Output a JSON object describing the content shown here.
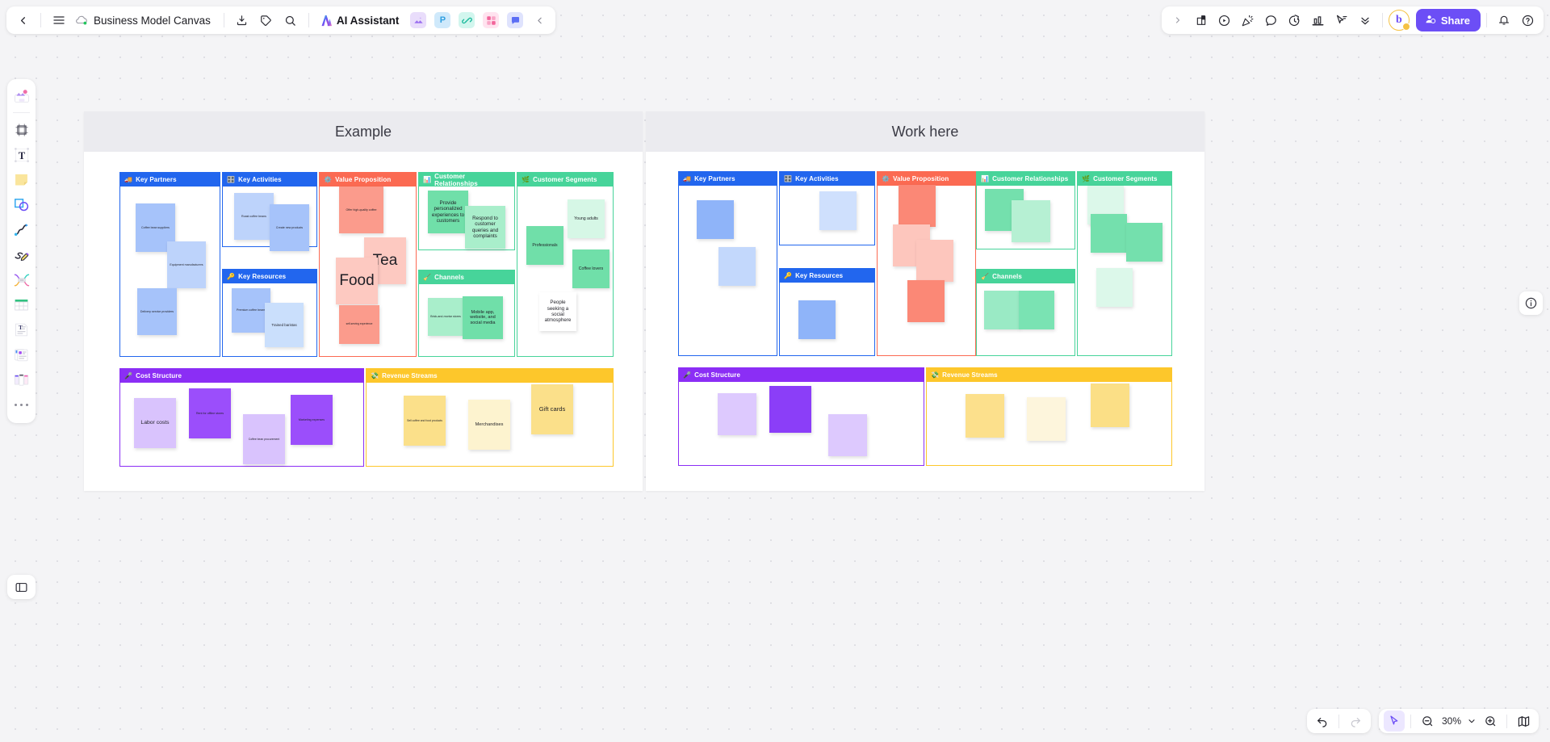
{
  "topbar": {
    "back_icon": "chevron-left-icon",
    "menu_icon": "hamburger-menu-icon",
    "doc_title": "Business Model Canvas",
    "download_icon": "download-icon",
    "tag_icon": "tag-icon",
    "search_icon": "search-icon",
    "ai_assistant_label": "AI Assistant",
    "chips": [
      {
        "name": "image-tool",
        "letter": "",
        "bg": "#e9ddfb",
        "fg": "#8b5cf6"
      },
      {
        "name": "presentation-tool",
        "letter": "P",
        "bg": "#cfe9fb",
        "fg": "#2f9fe0"
      },
      {
        "name": "link-tool",
        "letter": "",
        "bg": "#d2f6ee",
        "fg": "#17b89a"
      },
      {
        "name": "grid-tool",
        "letter": "",
        "bg": "#ffe3ef",
        "fg": "#f2649a"
      },
      {
        "name": "comment-tool",
        "letter": "",
        "bg": "#dfe3fd",
        "fg": "#5b6ef5"
      }
    ],
    "collapse_icon": "chevron-left-collapse-icon",
    "right_expand_icon": "chevron-right-icon",
    "right_icons": [
      "present-file-icon",
      "play-circle-icon",
      "party-popper-icon",
      "comment-bubble-icon",
      "timer-icon",
      "chart-bar-icon",
      "cursor-vote-icon",
      "chevrons-down-icon"
    ],
    "share_label": "Share",
    "share_icon": "user-add-icon",
    "share_color": "#6c4ef6",
    "avatar_letter": "b",
    "bell_icon": "bell-icon",
    "help_icon": "help-circle-icon"
  },
  "left_toolbar": {
    "items": [
      {
        "name": "templates-icon",
        "label": "Templates"
      },
      {
        "name": "frame-icon",
        "label": "Frame"
      },
      {
        "name": "text-icon",
        "label": "Text"
      },
      {
        "name": "sticky-note-icon",
        "label": "Sticky note"
      },
      {
        "name": "shapes-icon",
        "label": "Shapes"
      },
      {
        "name": "connector-icon",
        "label": "Connector line"
      },
      {
        "name": "pen-icon",
        "label": "Pen"
      },
      {
        "name": "mindmap-icon",
        "label": "Mind map"
      },
      {
        "name": "table-icon",
        "label": "Table"
      },
      {
        "name": "document-icon",
        "label": "Document"
      },
      {
        "name": "card-icon",
        "label": "Card"
      },
      {
        "name": "kanban-icon",
        "label": "Kanban"
      },
      {
        "name": "more-icon",
        "label": "More"
      }
    ],
    "bottom_item": {
      "name": "open-panel-icon",
      "label": "Open panel"
    }
  },
  "right_panel": {
    "info_icon": "info-circle-icon"
  },
  "bottom_bar": {
    "undo_icon": "undo-icon",
    "redo_icon": "redo-icon",
    "cursor_icon": "cursor-select-icon",
    "zoom_out_icon": "zoom-out-icon",
    "zoom_level": "30%",
    "zoom_dropdown_icon": "chevron-down-icon",
    "zoom_in_icon": "zoom-in-icon",
    "minimap_icon": "minimap-icon",
    "accent": "#6c4ef6"
  },
  "canvas": {
    "frames": [
      {
        "name": "frame-example",
        "title": "Example"
      },
      {
        "name": "frame-work-here",
        "title": "Work here"
      }
    ],
    "section_colors": {
      "key_partners": "#2266ee",
      "key_activities": "#2266ee",
      "key_resources": "#2266ee",
      "value_proposition": "#fb6a52",
      "customer_relationships": "#47d49a",
      "channels": "#47d49a",
      "customer_segments": "#47d49a",
      "cost_structure": "#8b2ef5",
      "revenue_streams": "#fdc72b"
    },
    "sections": [
      {
        "key": "key_partners",
        "title": "Key Partners",
        "emoji": "🚚"
      },
      {
        "key": "key_activities",
        "title": "Key Activities",
        "emoji": "🎛️"
      },
      {
        "key": "key_resources",
        "title": "Key Resources",
        "emoji": "🔑"
      },
      {
        "key": "value_proposition",
        "title": "Value Proposition",
        "emoji": "⚙️"
      },
      {
        "key": "customer_relationships",
        "title": "Customer Relationships",
        "emoji": "📊"
      },
      {
        "key": "channels",
        "title": "Channels",
        "emoji": "🧹"
      },
      {
        "key": "customer_segments",
        "title": "Customer Segments",
        "emoji": "🌿"
      },
      {
        "key": "cost_structure",
        "title": "Cost Structure",
        "emoji": "🎤"
      },
      {
        "key": "revenue_streams",
        "title": "Revenue Streams",
        "emoji": "💸"
      }
    ],
    "example_notes": {
      "key_partners": [
        {
          "text": "Coffee bean suppliers",
          "color": "#a6c3fa"
        },
        {
          "text": "Equipment manufacturers",
          "color": "#bdd3fb"
        },
        {
          "text": "Delivery service providers",
          "color": "#a6c3fa"
        }
      ],
      "key_activities": [
        {
          "text": "Roast coffee beans",
          "color": "#bdd3fb"
        },
        {
          "text": "Create new products",
          "color": "#a6c3fa"
        }
      ],
      "key_resources": [
        {
          "text": "Premium coffee beans",
          "color": "#a6c3fa"
        },
        {
          "text": "Trained baristas",
          "color": "#cadffc"
        }
      ],
      "value_proposition": [
        {
          "text": "Offer high-quality coffee",
          "color": "#fb9b8c"
        },
        {
          "text": "Tea",
          "color": "#fdc9c1"
        },
        {
          "text": "Food",
          "color": "#fdc9c1"
        },
        {
          "text": "self-serving experience",
          "color": "#fb9b8c"
        }
      ],
      "customer_relationships": [
        {
          "text": "Provide personalized experiences to customers",
          "color": "#70dfa9"
        },
        {
          "text": "Respond to customer queries and complaints",
          "color": "#a9eecb"
        }
      ],
      "channels": [
        {
          "text": "Brick-and-mortar stores",
          "color": "#a9eecb"
        },
        {
          "text": "Mobile app, website, and social media",
          "color": "#70dfa9"
        }
      ],
      "customer_segments": [
        {
          "text": "Professionals",
          "color": "#70dfa9"
        },
        {
          "text": "Young adults",
          "color": "#d6f7e6"
        },
        {
          "text": "Coffee lovers",
          "color": "#70dfa9"
        },
        {
          "text": "People seeking a social atmosphere",
          "color": "#ffffff"
        }
      ],
      "cost_structure": [
        {
          "text": "Labor costs",
          "color": "#d9c3fd"
        },
        {
          "text": "Rent for offline stores",
          "color": "#9b4efb"
        },
        {
          "text": "Coffee bean procurement",
          "color": "#d9c3fd"
        },
        {
          "text": "Marketing expenses",
          "color": "#9b4efb"
        }
      ],
      "revenue_streams": [
        {
          "text": "Sell coffee and food products",
          "color": "#fbe08a"
        },
        {
          "text": "Merchandises",
          "color": "#fdf3cf"
        },
        {
          "text": "Gift cards",
          "color": "#fbe08a"
        }
      ]
    },
    "work_notes": {
      "key_partners": [
        {
          "color": "#8fb4f9"
        },
        {
          "color": "#c3d8fc"
        }
      ],
      "key_activities": [
        {
          "color": "#cfe0fd"
        }
      ],
      "key_resources": [
        {
          "color": "#8fb4f9"
        }
      ],
      "value_proposition": [
        {
          "color": "#fb8876"
        },
        {
          "color": "#fdc6bd"
        },
        {
          "color": "#fdc6bd"
        },
        {
          "color": "#fb8876"
        }
      ],
      "customer_relationships": [
        {
          "color": "#74e0ad"
        },
        {
          "color": "#b6f0d3"
        }
      ],
      "channels": [
        {
          "color": "#9aeac5"
        },
        {
          "color": "#7ae3b3"
        }
      ],
      "customer_segments": [
        {
          "color": "#dcf8ea"
        },
        {
          "color": "#74e0ad"
        },
        {
          "color": "#74e0ad"
        },
        {
          "color": "#dcf8ea"
        }
      ],
      "cost_structure": [
        {
          "color": "#ddc9fe"
        },
        {
          "color": "#8b3ef8"
        },
        {
          "color": "#ddc9fe"
        }
      ],
      "revenue_streams": [
        {
          "color": "#fce08c"
        },
        {
          "color": "#fdf5dc"
        },
        {
          "color": "#fbdf86"
        }
      ]
    }
  }
}
